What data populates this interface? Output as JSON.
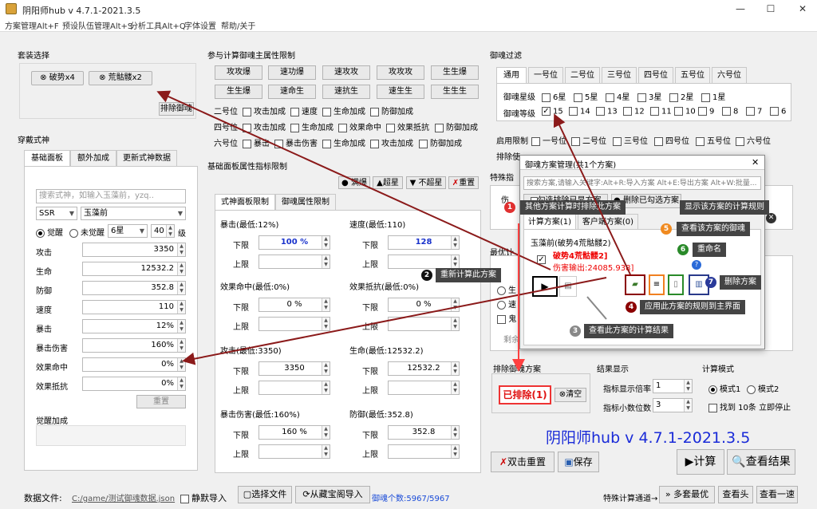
{
  "window": {
    "title": "阴阳师hub v 4.7.1-2021.3.5",
    "min": "—",
    "max": "☐",
    "close": "✕"
  },
  "menu": [
    "方案管理Alt+F",
    "预设队伍管理Alt+S",
    "分析工具Alt+Q",
    "字体设置",
    "帮助/关于"
  ],
  "set_select": {
    "title": "套装选择",
    "chips": [
      "破势x4",
      "荒骷髅x2"
    ],
    "exclude_btn": "排除御魂"
  },
  "shikigami": {
    "title": "穿戴式神",
    "tabs": [
      "基础面板",
      "额外加成",
      "更新式神数据"
    ],
    "search_placeholder": "搜索式神，如输入玉藻前，yzq..",
    "rarity": "SSR",
    "name": "玉藻前",
    "awake": "觉醒",
    "not_awake": "未觉醒",
    "star": "6星",
    "level": "40",
    "level_unit": "级",
    "stats": [
      {
        "label": "攻击",
        "value": "3350"
      },
      {
        "label": "生命",
        "value": "12532.2"
      },
      {
        "label": "防御",
        "value": "352.8"
      },
      {
        "label": "速度",
        "value": "110"
      },
      {
        "label": "暴击",
        "value": "12%"
      },
      {
        "label": "暴击伤害",
        "value": "160%"
      },
      {
        "label": "效果命中",
        "value": "0%"
      },
      {
        "label": "效果抵抗",
        "value": "0%"
      }
    ],
    "reset": "重置",
    "awake_bonus": "觉醒加成"
  },
  "main_attr": {
    "title": "参与计算御魂主属性限制",
    "btns": [
      "攻攻爆",
      "速功爆",
      "速攻攻",
      "攻攻攻",
      "生生爆",
      "生生爆",
      "速命生",
      "速抗生",
      "速生生",
      "生生生"
    ],
    "row2": {
      "label": "二号位",
      "opts": [
        "攻击加成",
        "速度",
        "生命加成",
        "防御加成"
      ]
    },
    "row4": {
      "label": "四号位",
      "opts": [
        "攻击加成",
        "生命加成",
        "效果命中",
        "效果抵抗",
        "防御加成"
      ]
    },
    "row6": {
      "label": "六号位",
      "opts": [
        "暴击",
        "暴击伤害",
        "生命加成",
        "攻击加成",
        "防御加成"
      ]
    }
  },
  "panel_limit": {
    "title": "基础面板属性指标限制",
    "actions": [
      "满爆",
      "超星",
      "不超星",
      "重置"
    ],
    "tabs": [
      "式神面板限制",
      "御魂属性限制"
    ],
    "low": "下限",
    "high": "上限",
    "fields": [
      {
        "name": "暴击(最低:12%)",
        "low": "100 %"
      },
      {
        "name": "速度(最低:110)",
        "low": "128"
      },
      {
        "name": "效果命中(最低:0%)",
        "low": "0 %"
      },
      {
        "name": "效果抵抗(最低:0%)",
        "low": "0 %"
      },
      {
        "name": "攻击(最低:3350)",
        "low": "3350"
      },
      {
        "name": "生命(最低:12532.2)",
        "low": "12532.2"
      },
      {
        "name": "暴击伤害(最低:160%)",
        "low": "160 %"
      },
      {
        "name": "防御(最低:352.8)",
        "low": "352.8"
      }
    ]
  },
  "filter": {
    "title": "御魂过滤",
    "tabs": [
      "通用",
      "一号位",
      "二号位",
      "三号位",
      "四号位",
      "五号位",
      "六号位"
    ],
    "star_label": "御魂星级",
    "stars": [
      "6星",
      "5星",
      "4星",
      "3星",
      "2星",
      "1星"
    ],
    "level_label": "御魂等级",
    "levels": [
      "15",
      "14",
      "13",
      "12",
      "11",
      "10",
      "9",
      "8",
      "7",
      "6"
    ],
    "enable_label": "启用限制",
    "positions": [
      "一号位",
      "二号位",
      "三号位",
      "四号位",
      "五号位",
      "六号位"
    ],
    "exclude_label": "排除使",
    "special": "特殊指"
  },
  "dialog": {
    "title": "御魂方案管理(共1个方案)",
    "search_placeholder": "搜索方案,请输入关键字:Alt+R:导入方案 Alt+E:导出方案 Alt+W:批量...",
    "btn_exclude": "勾选排除已显方案",
    "btn_del": "删除已勾选方案",
    "tabs": [
      "计算方案(1)",
      "客户端方案(0)"
    ],
    "plan_name": "玉藻前(破势4荒骷髅2)",
    "plan_line1": "破势4荒骷髅2]",
    "plan_line2": "伤害输出:24085.938]"
  },
  "callouts": {
    "c1": "其他方案计算时排除此方案",
    "c2": "重新计算此方案",
    "c3": "查看此方案的计算结果",
    "c4": "应用此方案的规则到主界面",
    "c5": "查看该方案的御魂",
    "c6": "重命名",
    "c7": "删除方案",
    "cs": "显示该方案的计算规则"
  },
  "exclude_plan": {
    "title": "排除御魂方案",
    "value": "已排除(1)",
    "clear": "清空"
  },
  "result_display": {
    "title": "结果显示",
    "ratio_label": "指标显示倍率",
    "ratio": "1",
    "decimals_label": "指标小数位数",
    "decimals": "3"
  },
  "calc_mode": {
    "title": "计算模式",
    "m1": "模式1",
    "m2": "模式2",
    "stop": "找到 10条 立即停止"
  },
  "brand": "阴阳师hub v 4.7.1-2021.3.5",
  "bottom_btns": {
    "reset": "双击重置",
    "save": "保存",
    "calc": "计算",
    "result": "查看结果"
  },
  "status": {
    "data_label": "数据文件:",
    "path": "C:/game/测试御魂数据.json",
    "silent": "静默导入",
    "choose": "选择文件",
    "import": "从藏宝阁导入",
    "count": "御魂个数:5967/5967",
    "special": "特殊计算通道→",
    "multi": "多套最优",
    "head": "查看头",
    "speed": "查看一速"
  },
  "misc": {
    "xie": "最优计",
    "shen": "生",
    "su": "速",
    "gui": "鬼",
    "sheng": "剩余",
    "left_under": "伤"
  }
}
